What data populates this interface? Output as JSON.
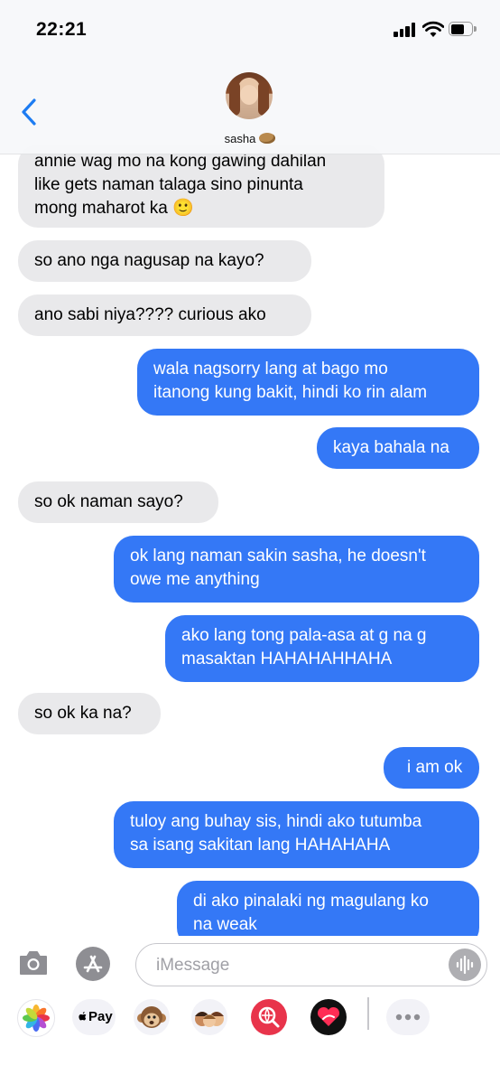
{
  "status_bar": {
    "time": "22:21"
  },
  "header": {
    "contact_name": "sasha",
    "contact_emoji_icon": "potato-icon"
  },
  "messages": [
    {
      "dir": "in",
      "text": "annie wag mo na kong gawing dahilan\nlike gets naman talaga sino pinunta\nmong maharot ka 🙂"
    },
    {
      "dir": "in",
      "text": "so ano nga nagusap na kayo?"
    },
    {
      "dir": "in",
      "text": "ano sabi niya???? curious ako"
    },
    {
      "dir": "out",
      "text": "wala nagsorry lang at bago mo\nitanong kung bakit, hindi ko rin alam"
    },
    {
      "dir": "out",
      "text": "kaya bahala na"
    },
    {
      "dir": "in",
      "text": "so ok naman sayo?"
    },
    {
      "dir": "out",
      "text": "ok lang naman sakin sasha, he doesn't\nowe me anything"
    },
    {
      "dir": "out",
      "text": "ako lang tong pala-asa at g na g\nmasaktan HAHAHAHHAHA"
    },
    {
      "dir": "in",
      "text": "so ok ka na?"
    },
    {
      "dir": "out",
      "text": "i am ok"
    },
    {
      "dir": "out",
      "text": "tuloy ang buhay sis, hindi ako tutumba\nsa isang sakitan lang HAHAHAHA"
    },
    {
      "dir": "out",
      "text": "di ako pinalaki ng magulang ko\nna weak"
    }
  ],
  "input_bar": {
    "placeholder": "iMessage"
  },
  "app_drawer": {
    "apps": [
      {
        "name": "photos-icon",
        "label": ""
      },
      {
        "name": "apple-pay-icon",
        "label": "Pay"
      },
      {
        "name": "animoji-icon",
        "label": ""
      },
      {
        "name": "memoji-icon",
        "label": ""
      },
      {
        "name": "web-search-icon",
        "label": ""
      },
      {
        "name": "digital-touch-icon",
        "label": ""
      },
      {
        "name": "more-icon",
        "label": ""
      }
    ]
  },
  "colors": {
    "incoming": "#e9e9eb",
    "outgoing": "#3478f6",
    "accent": "#1d7cf2"
  }
}
